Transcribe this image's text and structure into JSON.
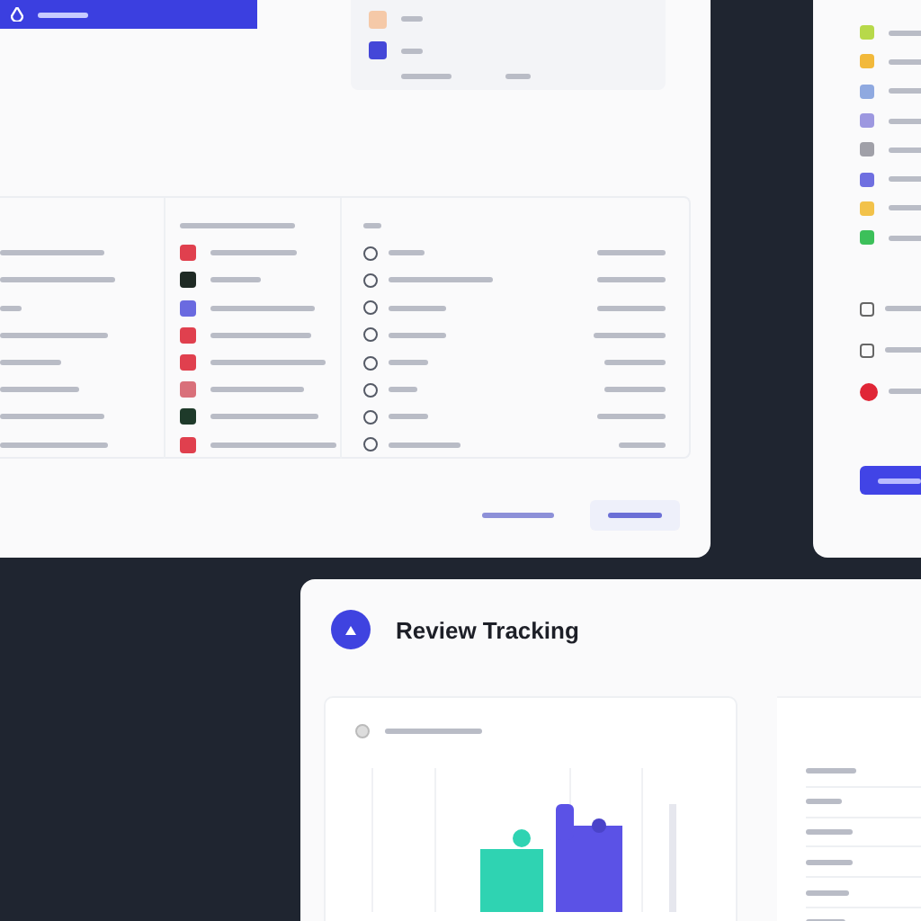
{
  "table": {
    "rows": [
      {
        "color": "#e0404e"
      },
      {
        "color": "#1f2a24"
      },
      {
        "color": "#6a6ae0"
      },
      {
        "color": "#e0404e"
      },
      {
        "color": "#e0404e"
      },
      {
        "color": "#d9707a"
      },
      {
        "color": "#1e3a2a"
      },
      {
        "color": "#e0404e"
      }
    ]
  },
  "card_rows": [
    {
      "color": "#f5c9a8"
    },
    {
      "color": "#4447d8"
    }
  ],
  "side_list": [
    {
      "color": "#b7d94a"
    },
    {
      "color": "#f2b93b"
    },
    {
      "color": "#8fa9e0"
    },
    {
      "color": "#9d98e0"
    },
    {
      "color": "#a0a0a8"
    },
    {
      "color": "#6f6fe0"
    },
    {
      "color": "#f2c24a"
    },
    {
      "color": "#3cc05a"
    }
  ],
  "side_actions": [
    {
      "kind": "square"
    },
    {
      "kind": "square"
    },
    {
      "kind": "alert"
    }
  ],
  "review": {
    "title": "Review Tracking"
  }
}
